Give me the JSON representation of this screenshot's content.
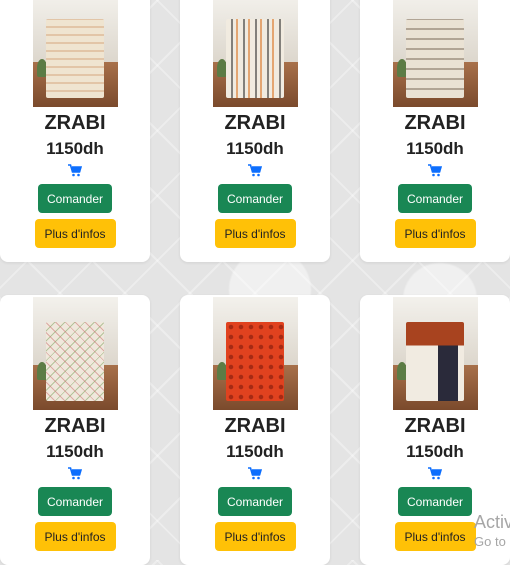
{
  "products": [
    {
      "name": "ZRABI",
      "price": "1150dh",
      "order_label": "Comander",
      "info_label": "Plus d'infos",
      "rug_color": "#efe4d0",
      "rug_accent": "#c98b5a",
      "cart_icon": "cart-icon"
    },
    {
      "name": "ZRABI",
      "price": "1150dh",
      "order_label": "Comander",
      "info_label": "Plus d'infos",
      "rug_color": "#f1ebe0",
      "rug_accent": "#2e2e2e",
      "cart_icon": "cart-icon"
    },
    {
      "name": "ZRABI",
      "price": "1150dh",
      "order_label": "Comander",
      "info_label": "Plus d'infos",
      "rug_color": "#eae2d4",
      "rug_accent": "#6b5a48",
      "cart_icon": "cart-icon"
    },
    {
      "name": "ZRABI",
      "price": "1150dh",
      "order_label": "Comander",
      "info_label": "Plus d'infos",
      "rug_color": "#f0e8dc",
      "rug_accent": "#c66b6b",
      "cart_icon": "cart-icon"
    },
    {
      "name": "ZRABI",
      "price": "1150dh",
      "order_label": "Comander",
      "info_label": "Plus d'infos",
      "rug_color": "#e0421f",
      "rug_accent": "#8c1f0f",
      "cart_icon": "cart-icon"
    },
    {
      "name": "ZRABI",
      "price": "1150dh",
      "order_label": "Comander",
      "info_label": "Plus d'infos",
      "rug_color": "#f1ebe1",
      "rug_accent": "#c0362c",
      "cart_icon": "cart-icon"
    }
  ],
  "watermark": {
    "line1": "Activ",
    "line2": "Go to"
  },
  "colors": {
    "order_button": "#198754",
    "info_button": "#ffc107",
    "cart_icon": "#0d6efd"
  }
}
